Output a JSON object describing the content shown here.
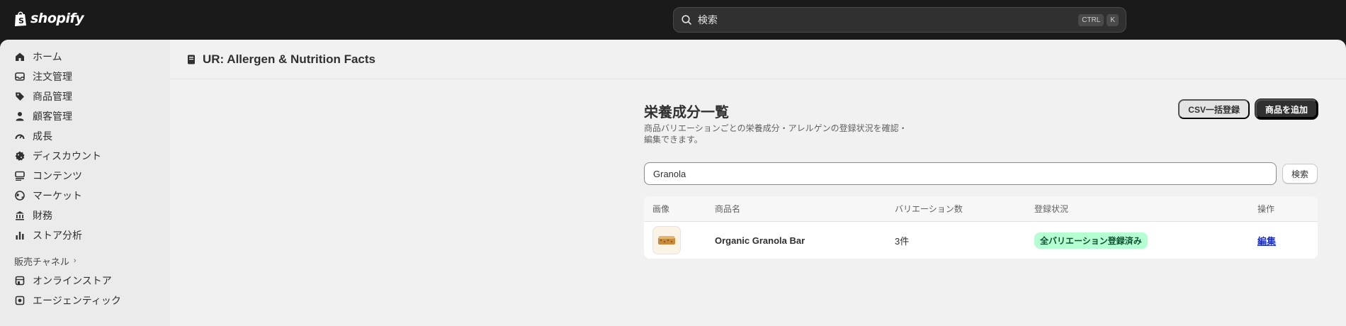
{
  "brand": {
    "logo_text": "shopify"
  },
  "search": {
    "placeholder": "検索",
    "shortcut_1": "CTRL",
    "shortcut_2": "K"
  },
  "sidebar": {
    "items": [
      {
        "label": "ホーム",
        "icon": "home-icon"
      },
      {
        "label": "注文管理",
        "icon": "inbox-icon"
      },
      {
        "label": "商品管理",
        "icon": "tag-icon"
      },
      {
        "label": "顧客管理",
        "icon": "person-icon"
      },
      {
        "label": "成長",
        "icon": "gauge-icon"
      },
      {
        "label": "ディスカウント",
        "icon": "discount-icon"
      },
      {
        "label": "コンテンツ",
        "icon": "content-icon"
      },
      {
        "label": "マーケット",
        "icon": "globe-icon"
      },
      {
        "label": "財務",
        "icon": "bank-icon"
      },
      {
        "label": "ストア分析",
        "icon": "chart-icon"
      }
    ],
    "section_label": "販売チャネル",
    "channels": [
      {
        "label": "オンラインストア",
        "icon": "store-icon"
      },
      {
        "label": "エージェンティック",
        "icon": "agentic-icon"
      }
    ]
  },
  "page": {
    "app_title": "UR: Allergen & Nutrition Facts"
  },
  "main": {
    "title": "栄養成分一覧",
    "description": "商品バリエーションごとの栄養成分・アレルゲンの登録状況を確認・編集できます。",
    "csv_button": "CSV一括登録",
    "add_button": "商品を追加",
    "filter_value": "Granola",
    "search_button": "検索",
    "table": {
      "headers": [
        "画像",
        "商品名",
        "バリエーション数",
        "登録状況",
        "操作"
      ],
      "rows": [
        {
          "name": "Organic Granola Bar",
          "variations": "3件",
          "status": "全バリエーション登録済み",
          "action": "編集"
        }
      ]
    }
  },
  "colors": {
    "accent": "#303030",
    "success_bg": "#b4fed2",
    "link": "#1a2fc7"
  }
}
